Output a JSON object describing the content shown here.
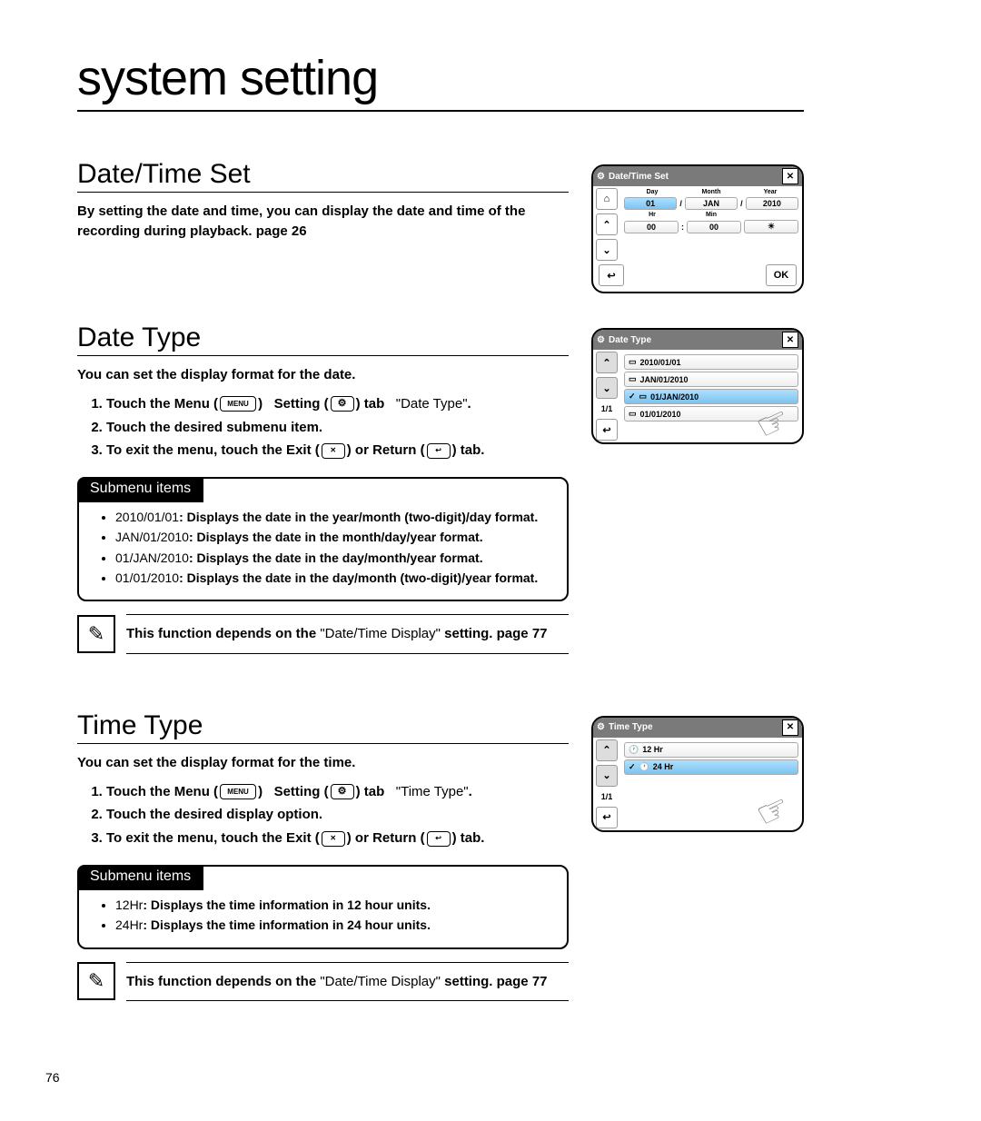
{
  "page_number": "76",
  "page_title": "system setting",
  "datetime_set": {
    "heading": "Date/Time Set",
    "body": "By setting the date and time, you can display the date and time of the recording during playback. page 26"
  },
  "date_type": {
    "heading": "Date Type",
    "intro": "You can set the display format for the date.",
    "steps": {
      "s1_pre": "Touch the Menu",
      "s1_menu_icon": "MENU",
      "s1_mid": "Setting",
      "s1_tab": "tab",
      "s1_item": "\"Date Type\"",
      "s2": "Touch the desired submenu item.",
      "s3_pre": "To exit the menu, touch the Exit",
      "s3_mid": "or Return",
      "s3_post": "tab."
    },
    "submenu_label": "Submenu items",
    "submenu": [
      {
        "lead": "2010/01/01",
        "desc": ": Displays the date in the year/month (two-digit)/day format."
      },
      {
        "lead": "JAN/01/2010",
        "desc": ": Displays the date in the month/day/year format."
      },
      {
        "lead": "01/JAN/2010",
        "desc": ": Displays the date in the day/month/year format."
      },
      {
        "lead": "01/01/2010",
        "desc": ": Displays the date in the day/month (two-digit)/year format."
      }
    ],
    "note_pre": "This function depends on the ",
    "note_q": "\"Date/Time Display\"",
    "note_post": " setting. page 77"
  },
  "time_type": {
    "heading": "Time Type",
    "intro": "You can set the display format for the time.",
    "steps": {
      "s1_pre": "Touch the Menu",
      "s1_menu_icon": "MENU",
      "s1_mid": "Setting",
      "s1_tab": "tab",
      "s1_item": "\"Time Type\"",
      "s2": "Touch the desired display option.",
      "s3_pre": "To exit the menu, touch the Exit",
      "s3_mid": "or Return",
      "s3_post": "tab."
    },
    "submenu_label": "Submenu items",
    "submenu": [
      {
        "lead": "12Hr",
        "desc": ": Displays the time information in 12 hour units."
      },
      {
        "lead": "24Hr",
        "desc": ": Displays the time information in 24 hour units."
      }
    ],
    "note_pre": "This function depends on the ",
    "note_q": "\"Date/Time Display\"",
    "note_post": " setting. page 77"
  },
  "lcd1": {
    "title": "Date/Time Set",
    "labels": {
      "day": "Day",
      "month": "Month",
      "year": "Year",
      "hr": "Hr",
      "min": "Min"
    },
    "day": "01",
    "month": "JAN",
    "year": "2010",
    "hr": "00",
    "min": "00",
    "ok": "OK"
  },
  "lcd2": {
    "title": "Date Type",
    "items": [
      "2010/01/01",
      "JAN/01/2010",
      "01/JAN/2010",
      "01/01/2010"
    ],
    "selected": 2,
    "page": "1/1"
  },
  "lcd3": {
    "title": "Time Type",
    "items": [
      "12 Hr",
      "24 Hr"
    ],
    "selected": 1,
    "page": "1/1"
  },
  "glyphs": {
    "gear": "⚙",
    "close": "✕",
    "up": "⌃",
    "down": "⌄",
    "return": "↩",
    "home": "⌂",
    "check": "✓",
    "clock": "🕐",
    "pencil": "✎",
    "hand": "☞"
  }
}
